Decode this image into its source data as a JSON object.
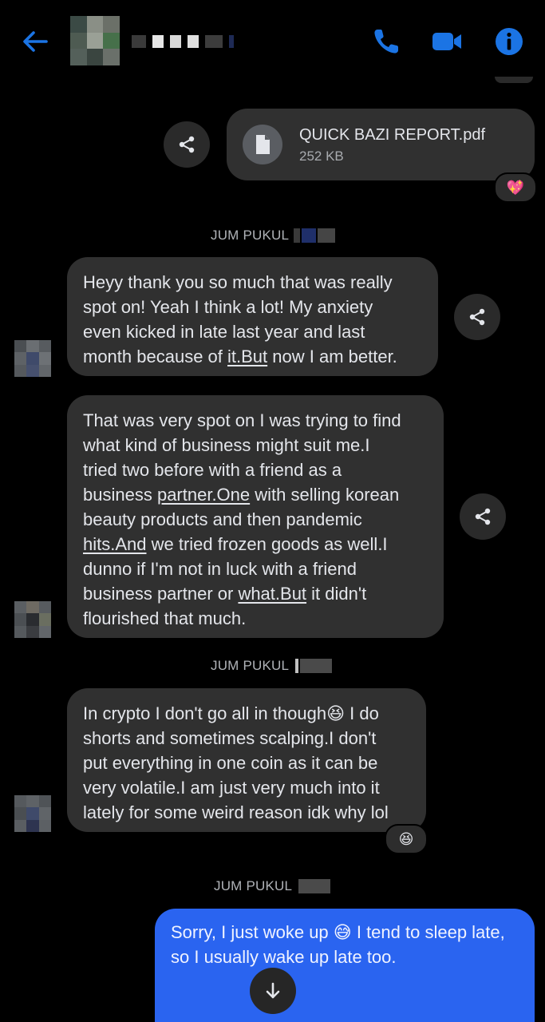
{
  "header": {
    "back_icon": "arrow-left-icon",
    "contact_name": "",
    "call_icon": "phone-icon",
    "video_icon": "video-camera-icon",
    "info_icon": "info-icon",
    "accent": "#1b74e4"
  },
  "messages": {
    "file": {
      "name": "QUICK BAZI REPORT.pdf",
      "size": "252 KB",
      "icon": "file-icon",
      "reaction": "💖"
    },
    "group1": {
      "timestamp": "JUM PUKUL",
      "msg1": {
        "line1": "Heyy thank you so much that was really",
        "line2": "spot on! Yeah I think a lot! My anxiety",
        "line3": "even kicked in late last year and last",
        "line4a": "month because of ",
        "line4b": "it.But",
        "line4c": " now I am better."
      },
      "msg2": {
        "line1": "That was very spot on I was trying to find",
        "line2": "what kind of business might suit me.I",
        "line3": "tried two before with a friend as a",
        "line4a": "business ",
        "line4b": "partner.One",
        "line4c": " with selling korean",
        "line5": "beauty products and then pandemic",
        "line6a": "hits.And",
        "line6b": " we tried frozen goods as well.I",
        "line7": "dunno if I'm not in luck with a friend",
        "line8a": "business partner or ",
        "line8b": "what.But",
        "line8c": " it didn't",
        "line9": "flourished that much."
      }
    },
    "group2": {
      "timestamp": "JUM PUKUL",
      "msg1": {
        "line1": "In crypto I don't go all in though😆 I do",
        "line2": "shorts and sometimes scalping.I don't",
        "line3": "put everything in one coin as it can be",
        "line4": "very volatile.I am just very much into it",
        "line5": "lately for some weird reason idk why lol"
      },
      "reaction": "😆"
    },
    "group3": {
      "timestamp": "JUM PUKUL",
      "mine": {
        "line1": "Sorry, I just woke up 😅",
        "line2": "I tend to sleep late, so I usually wake up",
        "line3": "late too."
      }
    }
  },
  "share_icon": "share-icon",
  "scroll_down_icon": "arrow-down-icon",
  "colors": {
    "background": "#000000",
    "incoming_bubble": "#303030",
    "outgoing_bubble": "#2a64f0",
    "timestamp": "#b0b3b8"
  }
}
